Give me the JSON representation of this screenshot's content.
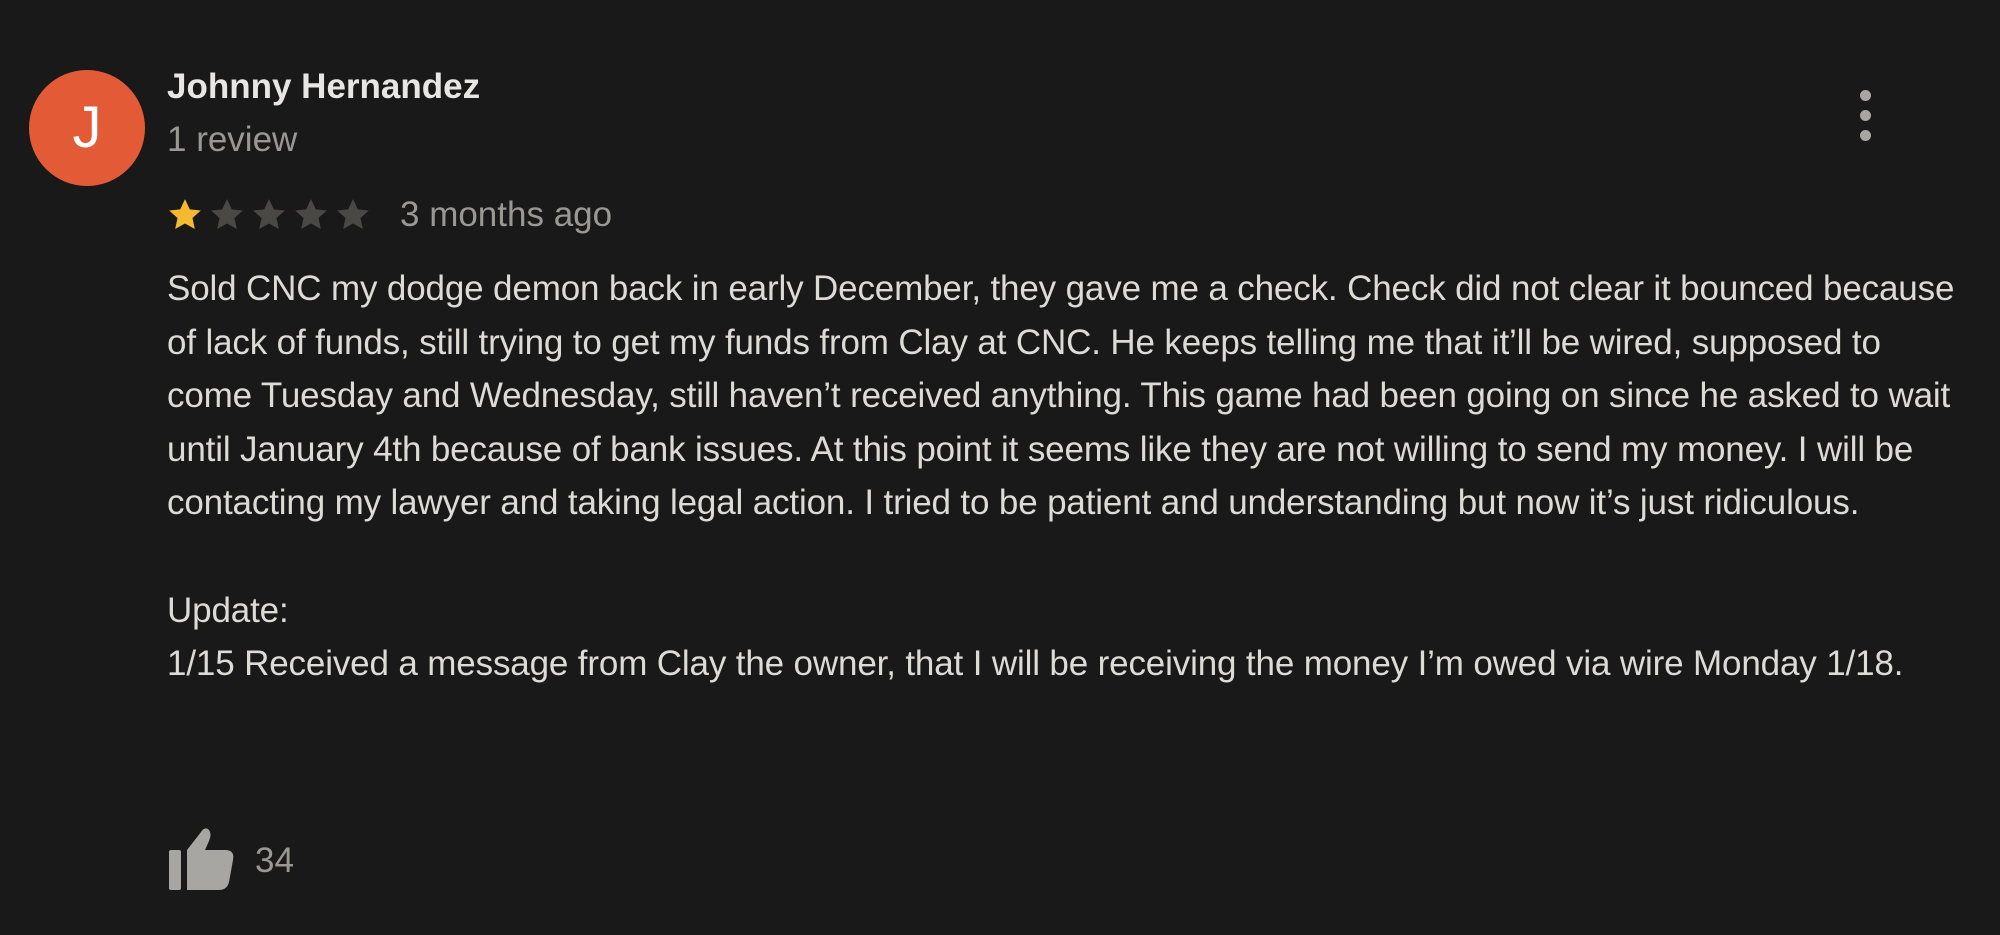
{
  "review": {
    "author": {
      "initial": "J",
      "name": "Johnny Hernandez",
      "review_count": "1 review",
      "avatar_color": "#e35b36"
    },
    "rating": {
      "value": 1,
      "max": 5,
      "filled_color": "#f5b931",
      "empty_color": "#4a4845"
    },
    "date": "3 months ago",
    "text": "Sold CNC my dodge demon back in early December, they gave me a check. Check did not clear it bounced because of lack of funds, still trying to get my funds from Clay at CNC. He keeps telling me that it’ll be wired, supposed to come Tuesday and Wednesday, still haven’t received anything. This game had been going on since he asked to wait until January 4th because of bank issues. At this point it seems like they are not willing to send my money. I will be contacting my lawyer and taking legal action. I tried to be patient and understanding but now it’s just ridiculous.\n\nUpdate:\n1/15 Received a message from Clay the owner, that I will be receiving the money I’m owed via wire Monday 1/18.",
    "likes": "34",
    "icons": {
      "more": "more-vert-icon",
      "like": "thumbs-up-icon",
      "star": "star-icon"
    }
  }
}
